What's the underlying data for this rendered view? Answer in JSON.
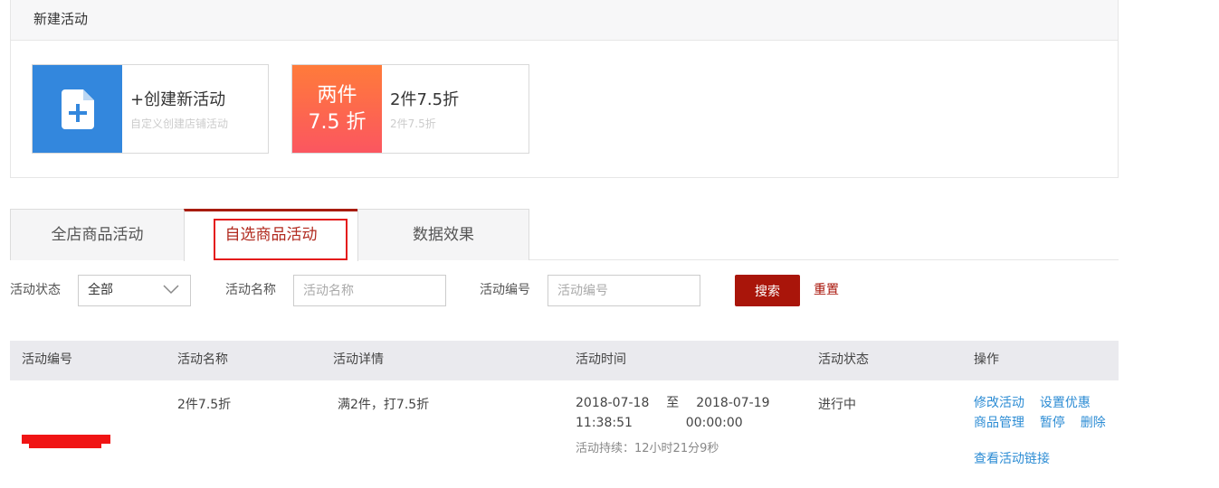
{
  "new_activity": {
    "title": "新建活动",
    "cards": [
      {
        "title": "+创建新活动",
        "subtitle": "自定义创建店铺活动"
      },
      {
        "badge_line1": "两件",
        "badge_line2": "7.5 折",
        "title": "2件7.5折",
        "subtitle": "2件7.5折"
      }
    ]
  },
  "tabs": [
    "全店商品活动",
    "自选商品活动",
    "数据效果"
  ],
  "active_tab": 1,
  "filters": {
    "status_label": "活动状态",
    "status_value": "全部",
    "name_label": "活动名称",
    "name_placeholder": "活动名称",
    "id_label": "活动编号",
    "id_placeholder": "活动编号",
    "search_label": "搜索",
    "reset_label": "重置"
  },
  "table": {
    "headers": [
      "活动编号",
      "活动名称",
      "活动详情",
      "活动时间",
      "活动状态",
      "操作"
    ],
    "rows": [
      {
        "id": "",
        "name": "2件7.5折",
        "detail": "满2件，打7.5折",
        "start_date": "2018-07-18",
        "start_time": "11:38:51",
        "to": "至",
        "end_date": "2018-07-19",
        "end_time": "00:00:00",
        "duration": "活动持续：12小时21分9秒",
        "status": "进行中",
        "actions": {
          "edit": "修改活动",
          "discount": "设置优惠",
          "goods": "商品管理",
          "pause": "暂停",
          "delete": "删除",
          "link": "查看活动链接"
        }
      }
    ]
  },
  "colors": {
    "accent": "#a9150a",
    "link": "#2c8cd4",
    "card_blue": "#3387dd",
    "highlight": "#e41b1b"
  }
}
